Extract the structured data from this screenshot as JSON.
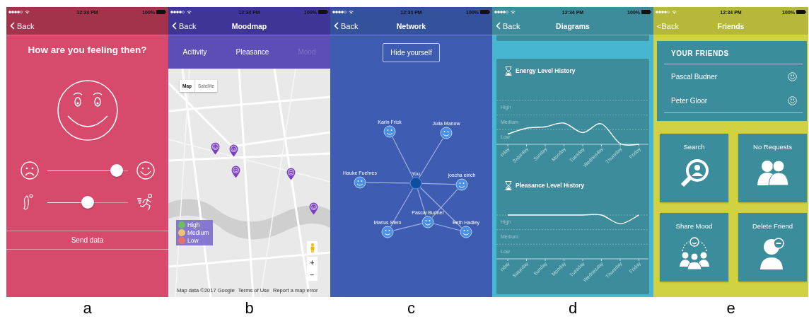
{
  "panels": [
    {
      "kind": "feelings",
      "label": "a",
      "status": {
        "time": "12:34 PM",
        "battery": "100%"
      },
      "nav": {
        "back": "Back",
        "chevron": true
      },
      "question": "How are you feeling then?",
      "sliders": [
        {
          "kind": "mood",
          "level": 0.86
        },
        {
          "kind": "energy",
          "level": 0.5
        }
      ],
      "send_button": "Send data"
    },
    {
      "kind": "moodmap",
      "label": "b",
      "status": {
        "time": "12:34 PM",
        "battery": "100%"
      },
      "nav": {
        "back": "Back",
        "chevron": true,
        "title": "Moodmap"
      },
      "tabs": [
        {
          "label": "Acitivity",
          "disabled": false
        },
        {
          "label": "Pleasance",
          "disabled": false
        },
        {
          "label": "Mood",
          "disabled": true
        }
      ],
      "map_types": [
        {
          "label": "Map",
          "selected": true
        },
        {
          "label": "Satellite",
          "selected": false
        }
      ],
      "legend": [
        {
          "label": "High",
          "color": "#6cbf5a"
        },
        {
          "label": "Medium",
          "color": "#f2c46b"
        },
        {
          "label": "Low",
          "color": "#e8706a"
        }
      ],
      "zoom": [
        "+",
        "−"
      ],
      "attribution": [
        "Map data ©2017 Google",
        "Terms of Use",
        "Report a map error"
      ]
    },
    {
      "kind": "network",
      "label": "c",
      "status": {
        "time": "12:34 PM",
        "battery": "100%"
      },
      "nav": {
        "back": "Back",
        "chevron": true,
        "title": "Network"
      },
      "hide_button": "Hide yourself",
      "nodes": [
        {
          "name": "Karin Frick",
          "kind": "friend"
        },
        {
          "name": "Julia Manow",
          "kind": "friend"
        },
        {
          "name": "Hauke Fuehres",
          "kind": "friend"
        },
        {
          "name": "You",
          "kind": "self"
        },
        {
          "name": "joscha eirich",
          "kind": "friend"
        },
        {
          "name": "Pascal Budner",
          "kind": "friend"
        },
        {
          "name": "Marius Stein",
          "kind": "friend"
        },
        {
          "name": "Beth Hadley",
          "kind": "friend"
        }
      ]
    },
    {
      "kind": "diagrams",
      "label": "d",
      "status": {
        "time": "12:34 PM",
        "battery": "100%"
      },
      "nav": {
        "back": "Back",
        "chevron": true,
        "title": "Diagrams"
      },
      "charts": [
        {
          "title": "Energy Level History",
          "y_labels": [
            "High",
            "Medium",
            "Low"
          ],
          "x_labels": [
            "riday",
            "Saturday",
            "Sunday",
            "Monday",
            "Tuesday",
            "Wednesday",
            "Thursday",
            "Friday"
          ]
        },
        {
          "title": "Pleasance Level History",
          "y_labels": [
            "High",
            "Medium",
            "Low"
          ],
          "x_labels": [
            "riday",
            "Saturday",
            "Sunday",
            "Monday",
            "Tuesday",
            "Wednesday",
            "Thursday",
            "Friday"
          ]
        }
      ]
    },
    {
      "kind": "friends",
      "label": "e",
      "status": {
        "time": "12:34 PM",
        "battery": "100%"
      },
      "nav": {
        "back": "<Back",
        "chevron": false,
        "title": "Friends"
      },
      "friends_header": "YOUR FRIENDS",
      "friends": [
        {
          "name": "Pascal Budner"
        },
        {
          "name": "Peter Gloor"
        }
      ],
      "tiles": [
        {
          "kind": "search",
          "label": "Search"
        },
        {
          "kind": "requests",
          "label": "No Requests"
        },
        {
          "kind": "share",
          "label": "Share Mood"
        },
        {
          "kind": "delete",
          "label": "Delete Friend"
        }
      ]
    }
  ]
}
